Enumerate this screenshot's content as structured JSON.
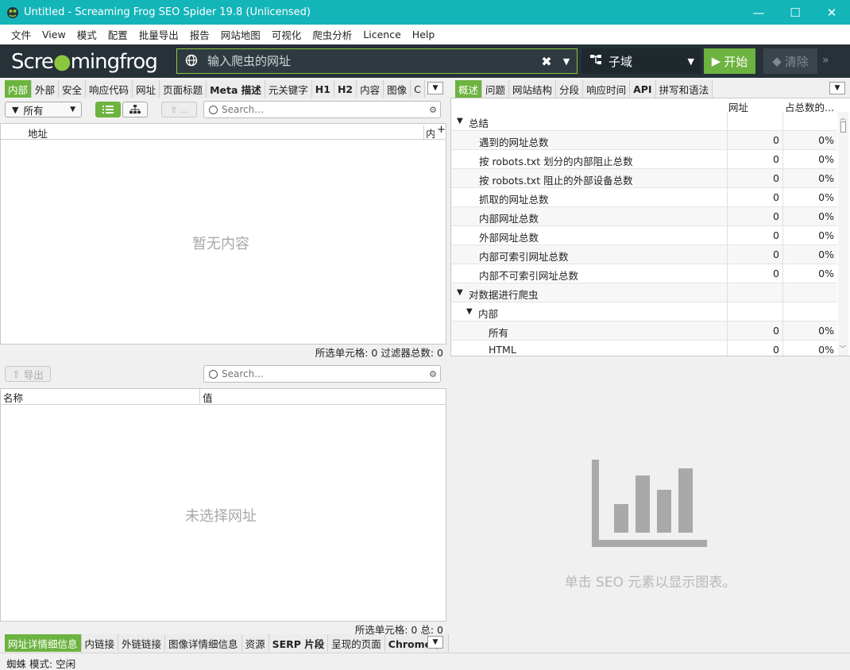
{
  "window": {
    "title": "Untitled - Screaming Frog SEO Spider 19.8 (Unlicensed)",
    "minimize": "—",
    "maximize": "☐",
    "close": "✕"
  },
  "menu": [
    "文件",
    "View",
    "模式",
    "配置",
    "批量导出",
    "报告",
    "网站地图",
    "可视化",
    "爬虫分析",
    "Licence",
    "Help"
  ],
  "toolbar": {
    "logo_main": "Scre",
    "logo_mid": "mingfrog",
    "url_placeholder": "输入爬虫的网址",
    "mode": "子域",
    "start": "开始",
    "clear": "清除",
    "more": "»"
  },
  "left_tabs": [
    "内部",
    "外部",
    "安全",
    "响应代码",
    "网址",
    "页面标题",
    "Meta 描述",
    "元关键字",
    "H1",
    "H2",
    "内容",
    "图像",
    "C"
  ],
  "right_tabs": [
    "概述",
    "问题",
    "网站结构",
    "分段",
    "响应时间",
    "API",
    "拼写和语法"
  ],
  "filter": {
    "all": "所有",
    "export_disabled": "...",
    "search_placeholder": "Search..."
  },
  "main_table": {
    "col_address": "地址",
    "col_next": "内容",
    "empty": "暂无内容",
    "status": "所选单元格:  0  过滤器总数:  0"
  },
  "overview": {
    "col_url": "网址",
    "col_pct": "占总数的...",
    "rows": [
      {
        "label": "总结",
        "toggle": "▼",
        "level": 0,
        "count": "",
        "pct": ""
      },
      {
        "label": "遇到的网址总数",
        "toggle": "",
        "level": 1,
        "count": "0",
        "pct": "0%"
      },
      {
        "label": "按 robots.txt 划分的内部阻止总数",
        "toggle": "",
        "level": 1,
        "count": "0",
        "pct": "0%"
      },
      {
        "label": "按 robots.txt 阻止的外部设备总数",
        "toggle": "",
        "level": 1,
        "count": "0",
        "pct": "0%"
      },
      {
        "label": "抓取的网址总数",
        "toggle": "",
        "level": 1,
        "count": "0",
        "pct": "0%"
      },
      {
        "label": "内部网址总数",
        "toggle": "",
        "level": 1,
        "count": "0",
        "pct": "0%"
      },
      {
        "label": "外部网址总数",
        "toggle": "",
        "level": 1,
        "count": "0",
        "pct": "0%"
      },
      {
        "label": "内部可索引网址总数",
        "toggle": "",
        "level": 1,
        "count": "0",
        "pct": "0%"
      },
      {
        "label": "内部不可索引网址总数",
        "toggle": "",
        "level": 1,
        "count": "0",
        "pct": "0%"
      },
      {
        "label": "对数据进行爬虫",
        "toggle": "▼",
        "level": 0,
        "count": "",
        "pct": ""
      },
      {
        "label": "内部",
        "toggle": "▼",
        "level": 1,
        "count": "",
        "pct": ""
      },
      {
        "label": "所有",
        "toggle": "",
        "level": 2,
        "count": "0",
        "pct": "0%"
      },
      {
        "label": "HTML",
        "toggle": "",
        "level": 2,
        "count": "0",
        "pct": "0%"
      }
    ]
  },
  "details": {
    "export": "导出",
    "search_placeholder": "Search...",
    "col_name": "名称",
    "col_value": "值",
    "empty": "未选择网址",
    "status": "所选单元格:  0  总:  0"
  },
  "chart_panel": {
    "empty": "单击 SEO 元素以显示图表。"
  },
  "bottom_tabs": [
    "网址详情细信息",
    "内链接",
    "外链链接",
    "图像详情细信息",
    "资源",
    "SERP 片段",
    "呈现的页面",
    "Chrome 扌"
  ],
  "statusbar": "蜘蛛 模式: 空闲",
  "colors": {
    "accent": "#6cb33f",
    "titlebar": "#14b5b9",
    "toolbar": "#263138"
  }
}
